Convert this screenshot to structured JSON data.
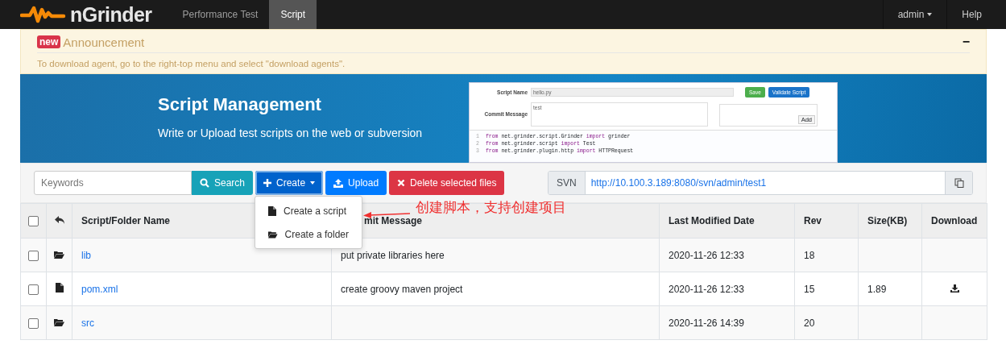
{
  "navbar": {
    "brand": "nGrinder",
    "tabs": [
      {
        "label": "Performance Test",
        "selected": false
      },
      {
        "label": "Script",
        "selected": true
      }
    ],
    "user": "admin",
    "help": "Help"
  },
  "announcement": {
    "badge": "new",
    "title": "Announcement",
    "collapse": "−",
    "text": "To download agent, go to the right-top menu and select \"download agents\"."
  },
  "banner": {
    "title": "Script Management",
    "subtitle": "Write or Upload test scripts on the web or subversion",
    "preview": {
      "script_name_label": "Script Name",
      "script_name": "hello.py",
      "save": "Save",
      "validate": "Validate Script",
      "commit_label": "Commit Message",
      "commit": "test",
      "add": "Add",
      "code": [
        {
          "line": "1",
          "parts": [
            {
              "t": "from",
              "kw": true
            },
            {
              "t": " net.grinder.script.Grinder ",
              "kw": false
            },
            {
              "t": "import",
              "kw": true
            },
            {
              "t": " grinder",
              "kw": false
            }
          ]
        },
        {
          "line": "2",
          "parts": [
            {
              "t": "from",
              "kw": true
            },
            {
              "t": " net.grinder.script ",
              "kw": false
            },
            {
              "t": "import",
              "kw": true
            },
            {
              "t": " Test",
              "kw": false
            }
          ]
        },
        {
          "line": "3",
          "parts": [
            {
              "t": "from",
              "kw": true
            },
            {
              "t": " net.grinder.plugin.http ",
              "kw": false
            },
            {
              "t": "import",
              "kw": true
            },
            {
              "t": " HTTPRequest",
              "kw": false
            }
          ]
        }
      ]
    }
  },
  "toolbar": {
    "search_placeholder": "Keywords",
    "search": "Search",
    "create": "Create",
    "upload": "Upload",
    "delete": "Delete selected files",
    "svn_label": "SVN",
    "svn_url": "http://10.100.3.189:8080/svn/admin/test1"
  },
  "create_menu": {
    "expanded": true,
    "items": [
      {
        "label": "Create a script",
        "kind": "file"
      },
      {
        "label": "Create a folder",
        "kind": "folder"
      }
    ]
  },
  "annotation": "创建脚本，支持创建项目",
  "table": {
    "select_all": false,
    "columns": [
      "Script/Folder Name",
      "mit Message",
      "Last Modified Date",
      "Rev",
      "Size(KB)",
      "Download"
    ],
    "rows": [
      {
        "checked": false,
        "kind": "folder",
        "name": "lib",
        "message": "put private libraries here",
        "date": "2020-11-26 12:33",
        "rev": "18",
        "size": "",
        "downloadable": false
      },
      {
        "checked": false,
        "kind": "file",
        "name": "pom.xml",
        "message": "create groovy maven project",
        "date": "2020-11-26 12:33",
        "rev": "15",
        "size": "1.89",
        "downloadable": true
      },
      {
        "checked": false,
        "kind": "folder",
        "name": "src",
        "message": "",
        "date": "2020-11-26 14:39",
        "rev": "20",
        "size": "",
        "downloadable": false
      }
    ]
  }
}
